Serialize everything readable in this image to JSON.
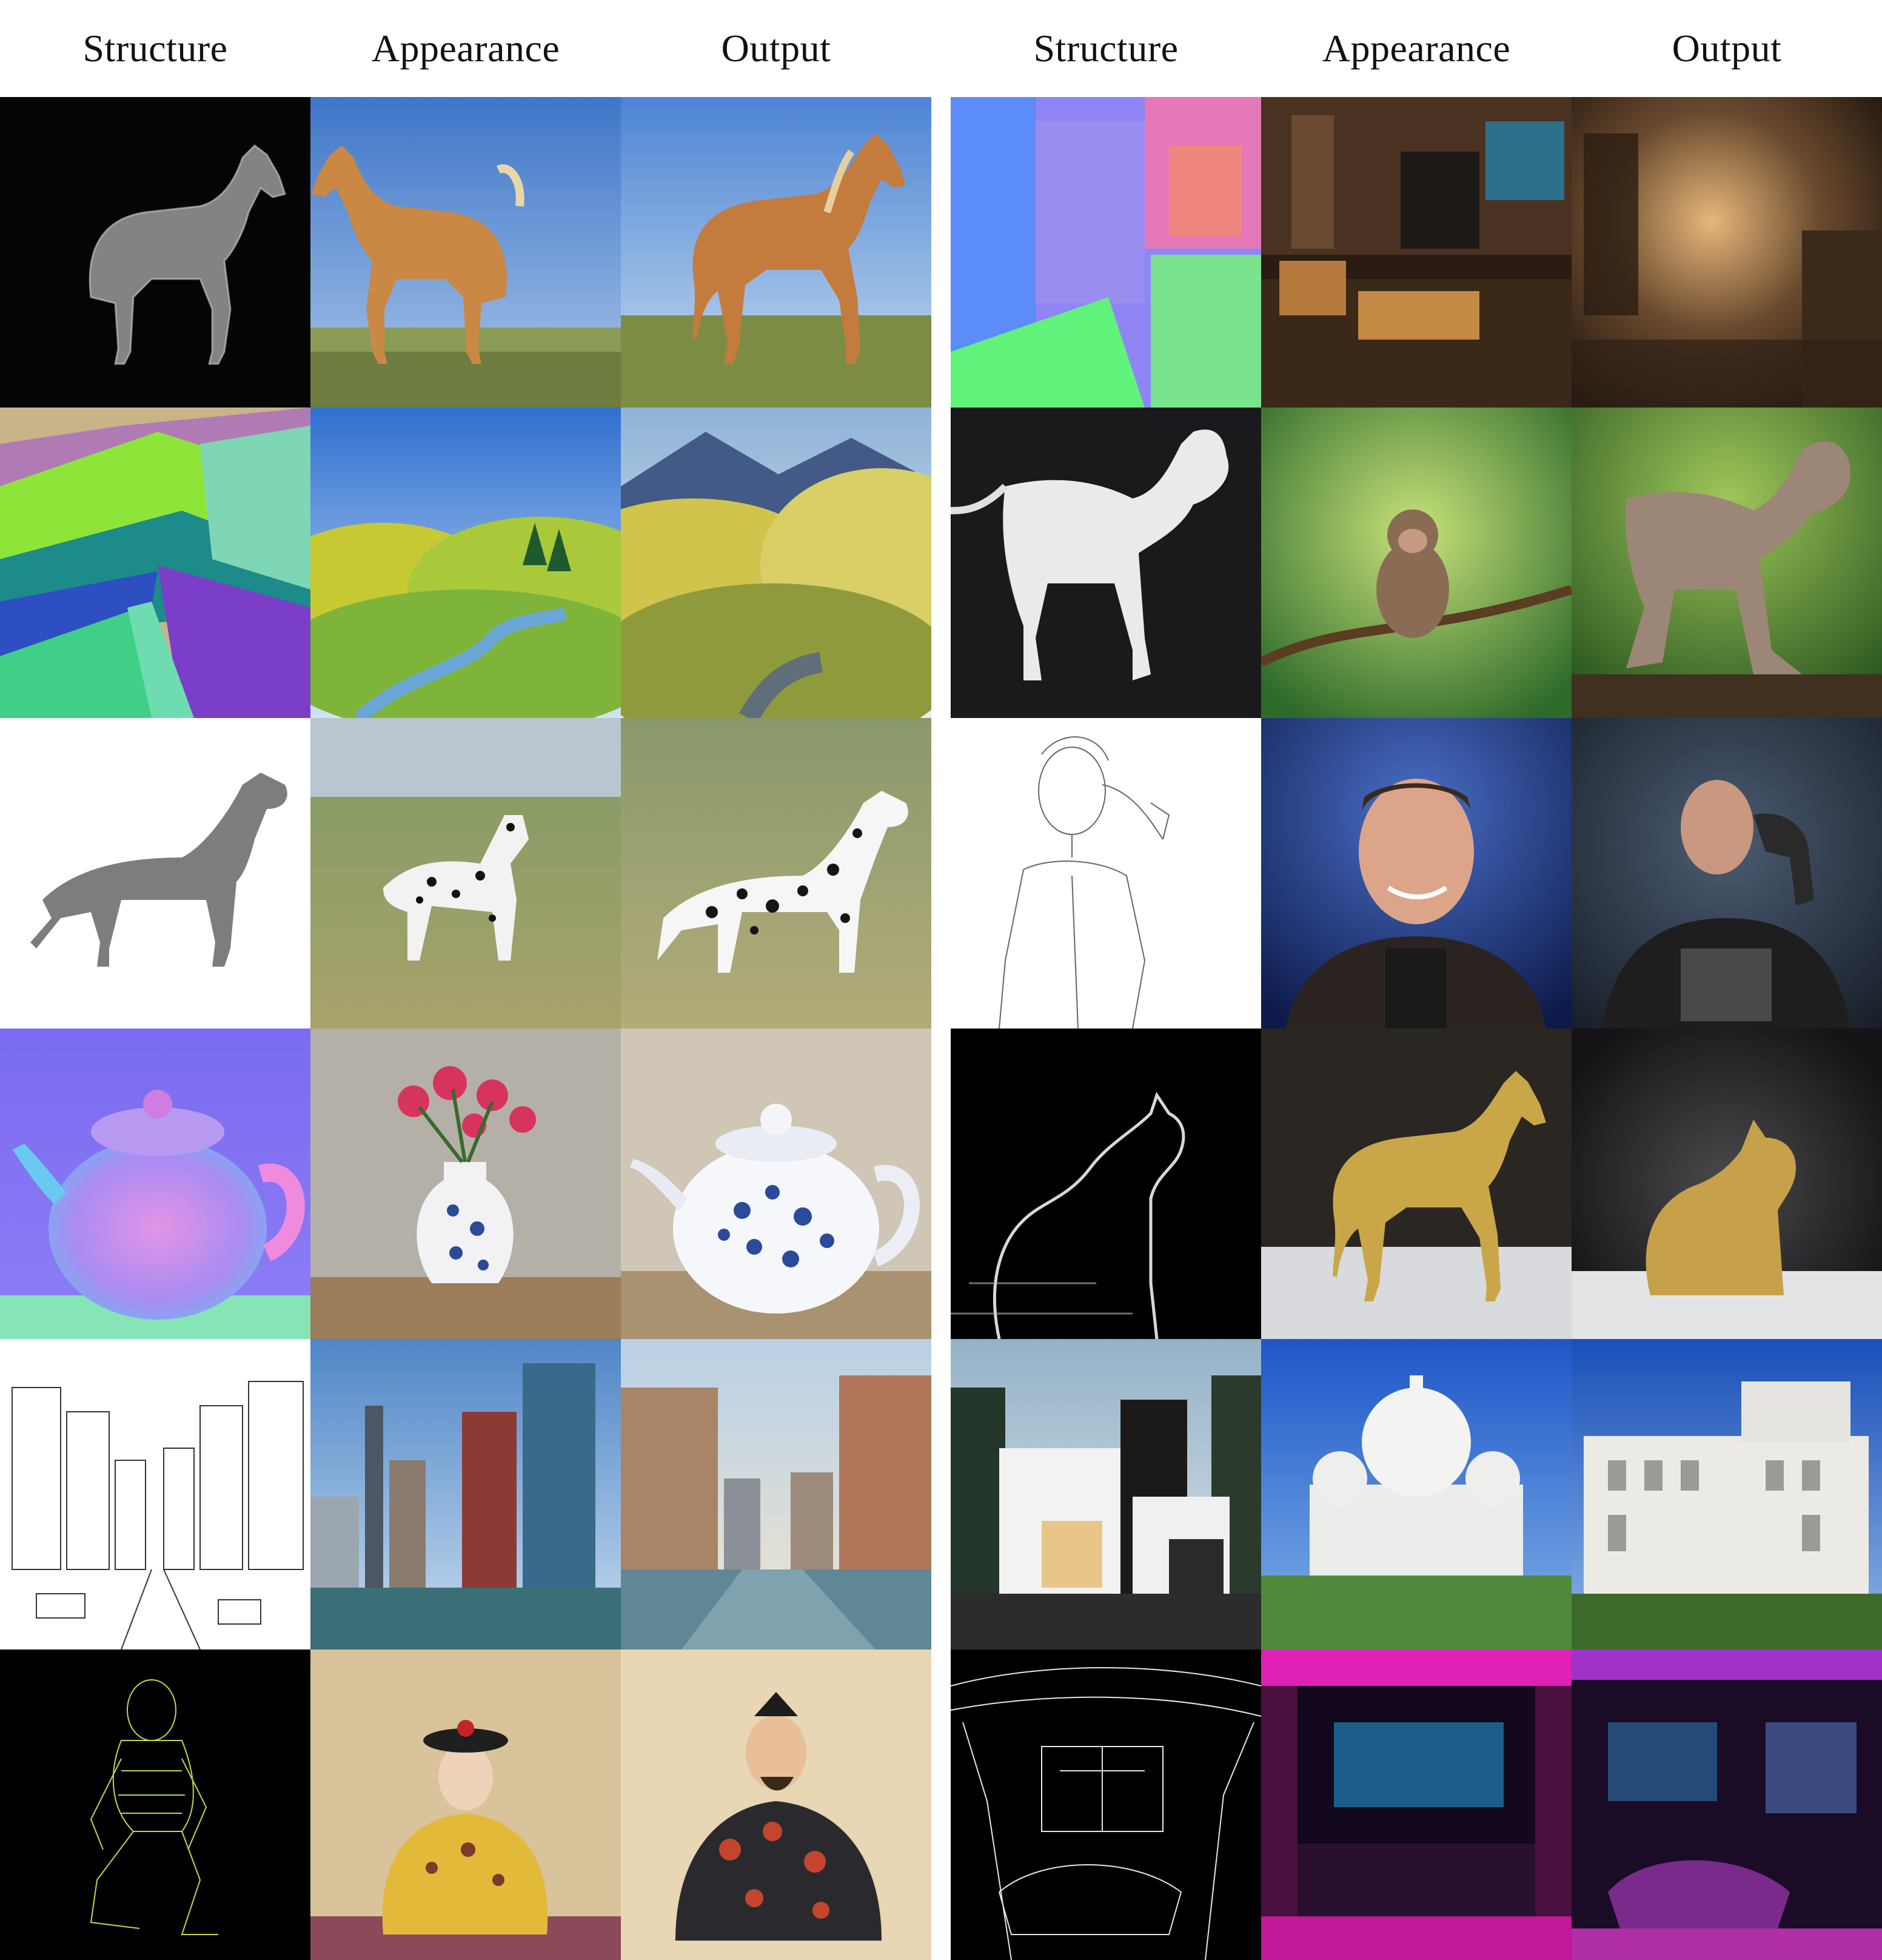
{
  "header": {
    "left": [
      "Structure",
      "Appearance",
      "Output"
    ],
    "right": [
      "Structure",
      "Appearance",
      "Output"
    ]
  },
  "rows": [
    {
      "left": [
        {
          "name": "horse-depth-structure",
          "kind": "depth-horse"
        },
        {
          "name": "palomino-horse-appearance",
          "kind": "photo-horse-left"
        },
        {
          "name": "horse-output",
          "kind": "photo-horse-right"
        }
      ],
      "right": [
        {
          "name": "room-normal-structure",
          "kind": "normal-room"
        },
        {
          "name": "cabin-interior-appearance",
          "kind": "cabin"
        },
        {
          "name": "kitchen-output",
          "kind": "kitchen"
        }
      ]
    },
    {
      "left": [
        {
          "name": "landscape-segmentation-structure",
          "kind": "segmentation"
        },
        {
          "name": "hills-painting-appearance",
          "kind": "hills-painting"
        },
        {
          "name": "valley-road-output",
          "kind": "valley-road"
        }
      ],
      "right": [
        {
          "name": "monkey-mesh-structure",
          "kind": "mesh-monkey"
        },
        {
          "name": "baby-monkey-appearance",
          "kind": "monkey-photo"
        },
        {
          "name": "monkey-output",
          "kind": "monkey-output"
        }
      ]
    },
    {
      "left": [
        {
          "name": "dog-mesh-structure",
          "kind": "mesh-dog"
        },
        {
          "name": "dalmatian-appearance",
          "kind": "dalmatian-photo"
        },
        {
          "name": "dalmatian-output",
          "kind": "dalmatian-output"
        }
      ],
      "right": [
        {
          "name": "man-sketch-structure",
          "kind": "man-sketch"
        },
        {
          "name": "smiling-man-appearance",
          "kind": "man-photo"
        },
        {
          "name": "man-output",
          "kind": "man-output"
        }
      ]
    },
    {
      "left": [
        {
          "name": "teapot-normal-structure",
          "kind": "normal-teapot"
        },
        {
          "name": "flower-vase-appearance",
          "kind": "vase"
        },
        {
          "name": "porcelain-teapot-output",
          "kind": "teapot-output"
        }
      ],
      "right": [
        {
          "name": "cat-edge-structure",
          "kind": "cat-edge"
        },
        {
          "name": "golden-horse-statue-appearance",
          "kind": "gold-horse"
        },
        {
          "name": "golden-cat-output",
          "kind": "gold-cat"
        }
      ]
    },
    {
      "left": [
        {
          "name": "city-sketch-structure",
          "kind": "city-sketch"
        },
        {
          "name": "city-river-appearance",
          "kind": "city-photo"
        },
        {
          "name": "city-canal-output",
          "kind": "city-output"
        }
      ],
      "right": [
        {
          "name": "modern-house-structure",
          "kind": "modern-house"
        },
        {
          "name": "basilica-appearance",
          "kind": "basilica"
        },
        {
          "name": "white-palace-output",
          "kind": "palace"
        }
      ]
    },
    {
      "left": [
        {
          "name": "man-wireframe-structure",
          "kind": "wireframe-man"
        },
        {
          "name": "emperor-portrait-appearance",
          "kind": "emperor"
        },
        {
          "name": "seated-figure-output",
          "kind": "seated-figure"
        }
      ],
      "right": [
        {
          "name": "room-lines-structure",
          "kind": "room-lines"
        },
        {
          "name": "neon-room-appearance",
          "kind": "neon-room"
        },
        {
          "name": "neon-bedroom-output",
          "kind": "neon-bedroom"
        }
      ]
    }
  ]
}
